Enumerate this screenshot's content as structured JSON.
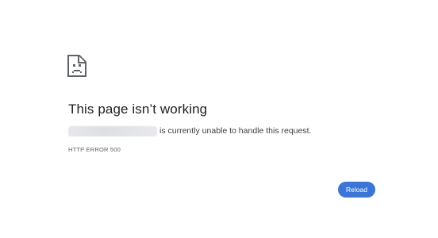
{
  "error": {
    "icon": "sad-document-icon",
    "title": "This page isn’t working",
    "message_suffix": "is currently unable to handle this request.",
    "code": "HTTP ERROR 500"
  },
  "actions": {
    "reload_label": "Reload"
  },
  "colors": {
    "accent": "#3b76d6",
    "title_text": "#202124",
    "body_text": "#3c4043",
    "muted_text": "#5f6368"
  }
}
